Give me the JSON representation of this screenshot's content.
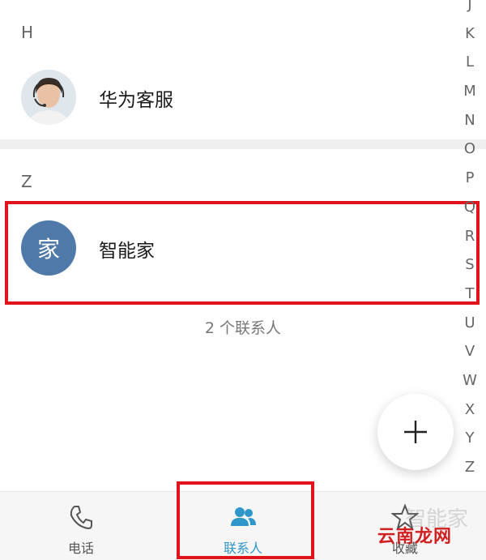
{
  "sections": [
    {
      "letter": "H",
      "contacts": [
        {
          "name": "华为客服",
          "avatar": "photo"
        }
      ]
    },
    {
      "letter": "Z",
      "contacts": [
        {
          "name": "智能家",
          "avatar_text": "家",
          "avatar_color": "#4f79a8"
        }
      ]
    }
  ],
  "contact_count": "2 个联系人",
  "alpha_index": [
    "J",
    "K",
    "L",
    "M",
    "N",
    "O",
    "P",
    "Q",
    "R",
    "S",
    "T",
    "U",
    "V",
    "W",
    "X",
    "Y",
    "Z"
  ],
  "fab_icon": "plus-icon",
  "bottom_nav": [
    {
      "label": "电话",
      "icon": "phone-icon",
      "active": false
    },
    {
      "label": "联系人",
      "icon": "contacts-icon",
      "active": true
    },
    {
      "label": "收藏",
      "icon": "star-icon",
      "active": false
    }
  ],
  "watermark": {
    "text": "云南龙网",
    "faint_text": "智能家"
  },
  "colors": {
    "accent": "#2f97c9",
    "highlight": "#e0141a",
    "avatar_blue": "#4f79a8"
  }
}
